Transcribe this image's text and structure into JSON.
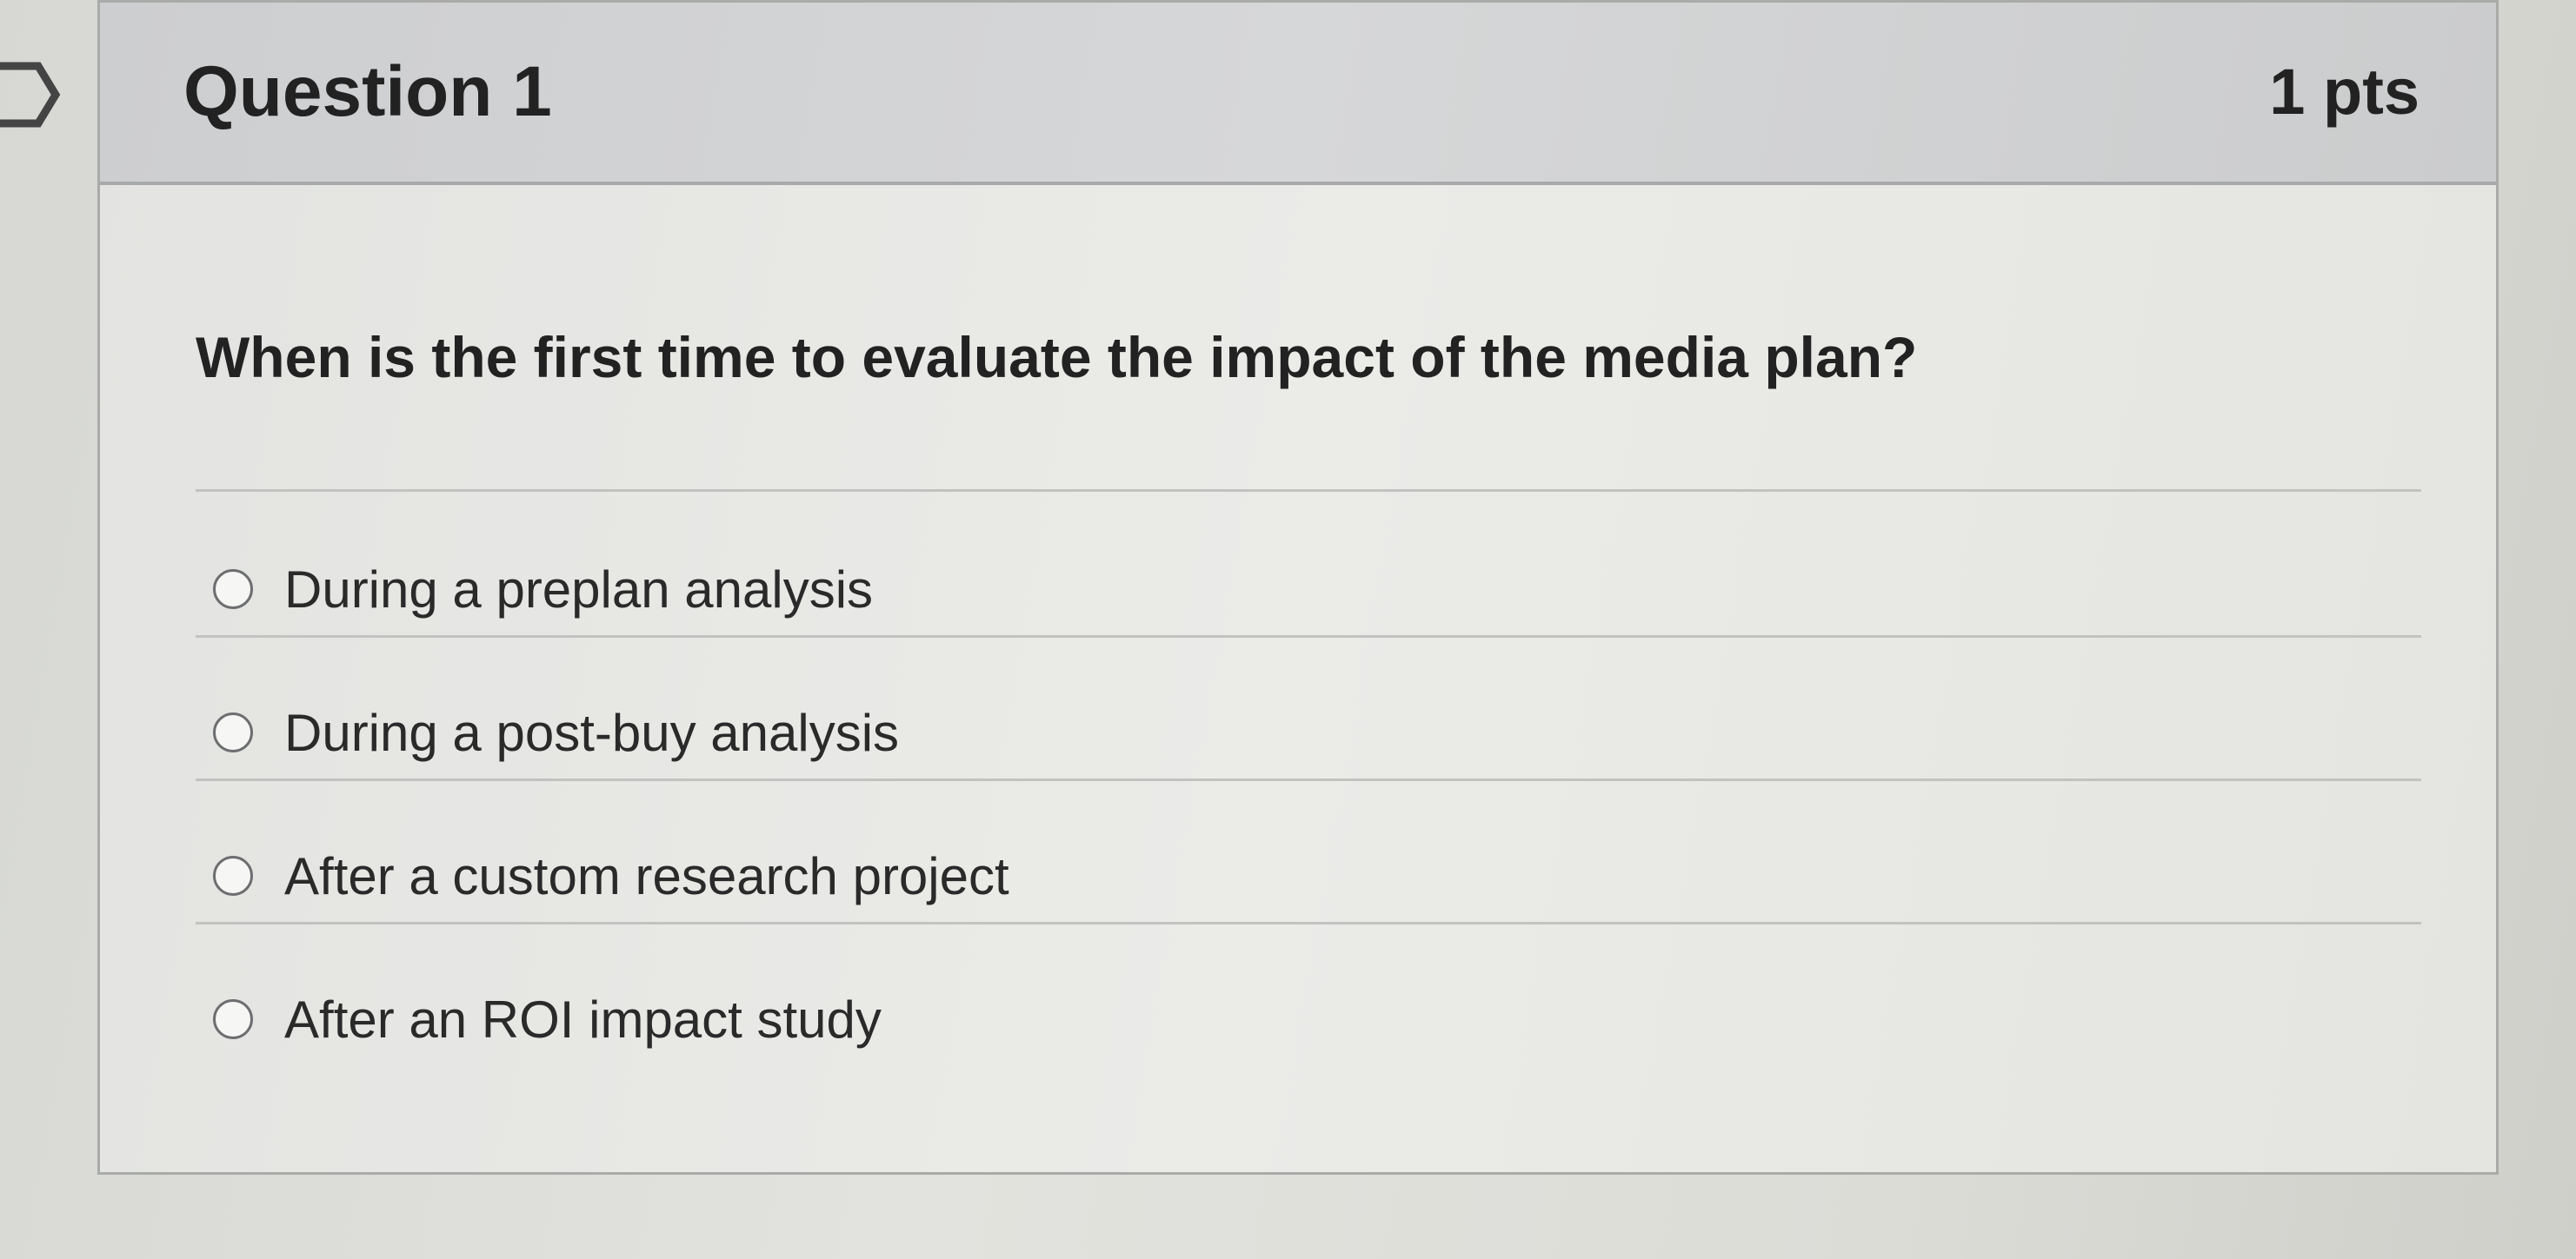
{
  "question": {
    "title": "Question 1",
    "points": "1 pts",
    "text": "When is the first time to evaluate the impact of the media plan?",
    "answers": [
      {
        "label": "During a preplan analysis",
        "selected": false
      },
      {
        "label": "During a post-buy analysis",
        "selected": false
      },
      {
        "label": "After a custom research project",
        "selected": false
      },
      {
        "label": "After an ROI impact study",
        "selected": false
      }
    ]
  },
  "icons": {
    "flag": "flag-icon",
    "radio": "radio-button-icon"
  },
  "colors": {
    "header_background": "#d3d4d5",
    "card_background": "#e8e8e5",
    "text": "#222222",
    "border": "#a9aba9"
  }
}
